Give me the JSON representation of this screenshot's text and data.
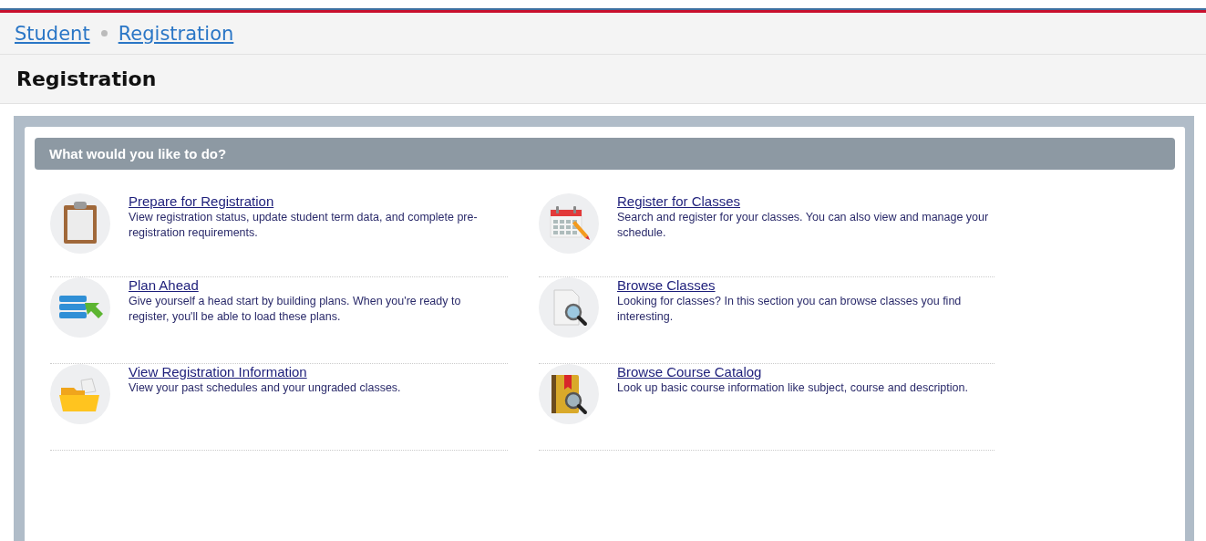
{
  "breadcrumbs": [
    "Student",
    "Registration"
  ],
  "page_title": "Registration",
  "panel": {
    "heading": "What would you like to do?",
    "actions": [
      {
        "title": "Prepare for Registration",
        "description": "View registration status, update student term data, and complete pre-registration requirements."
      },
      {
        "title": "Register for Classes",
        "description": "Search and register for your classes. You can also view and manage your schedule."
      },
      {
        "title": "Plan Ahead",
        "description": "Give yourself a head start by building plans. When you're ready to register, you'll be able to load these plans."
      },
      {
        "title": "Browse Classes",
        "description": "Looking for classes? In this section you can browse classes you find interesting."
      },
      {
        "title": "View Registration Information",
        "description": "View your past schedules and your ungraded classes."
      },
      {
        "title": "Browse Course Catalog",
        "description": "Look up basic course information like subject, course and description."
      }
    ]
  }
}
